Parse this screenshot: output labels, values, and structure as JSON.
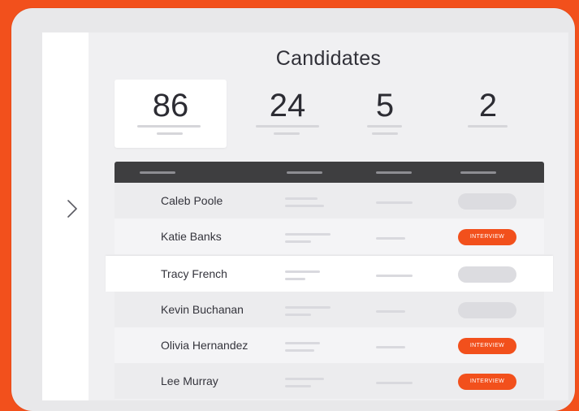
{
  "page": {
    "title": "Candidates"
  },
  "stats": [
    {
      "value": "86"
    },
    {
      "value": "24"
    },
    {
      "value": "5"
    },
    {
      "value": "2"
    }
  ],
  "candidates": [
    {
      "name": "Caleb Poole",
      "status": ""
    },
    {
      "name": "Katie Banks",
      "status": "INTERVIEW"
    },
    {
      "name": "Tracy French",
      "status": ""
    },
    {
      "name": "Kevin Buchanan",
      "status": ""
    },
    {
      "name": "Olivia Hernandez",
      "status": "INTERVIEW"
    },
    {
      "name": "Lee Murray",
      "status": "INTERVIEW"
    }
  ],
  "colors": {
    "accent": "#F2501C",
    "header": "#3e3e40",
    "text": "#303038"
  },
  "icons": {
    "expand": "chevron-right-icon"
  }
}
